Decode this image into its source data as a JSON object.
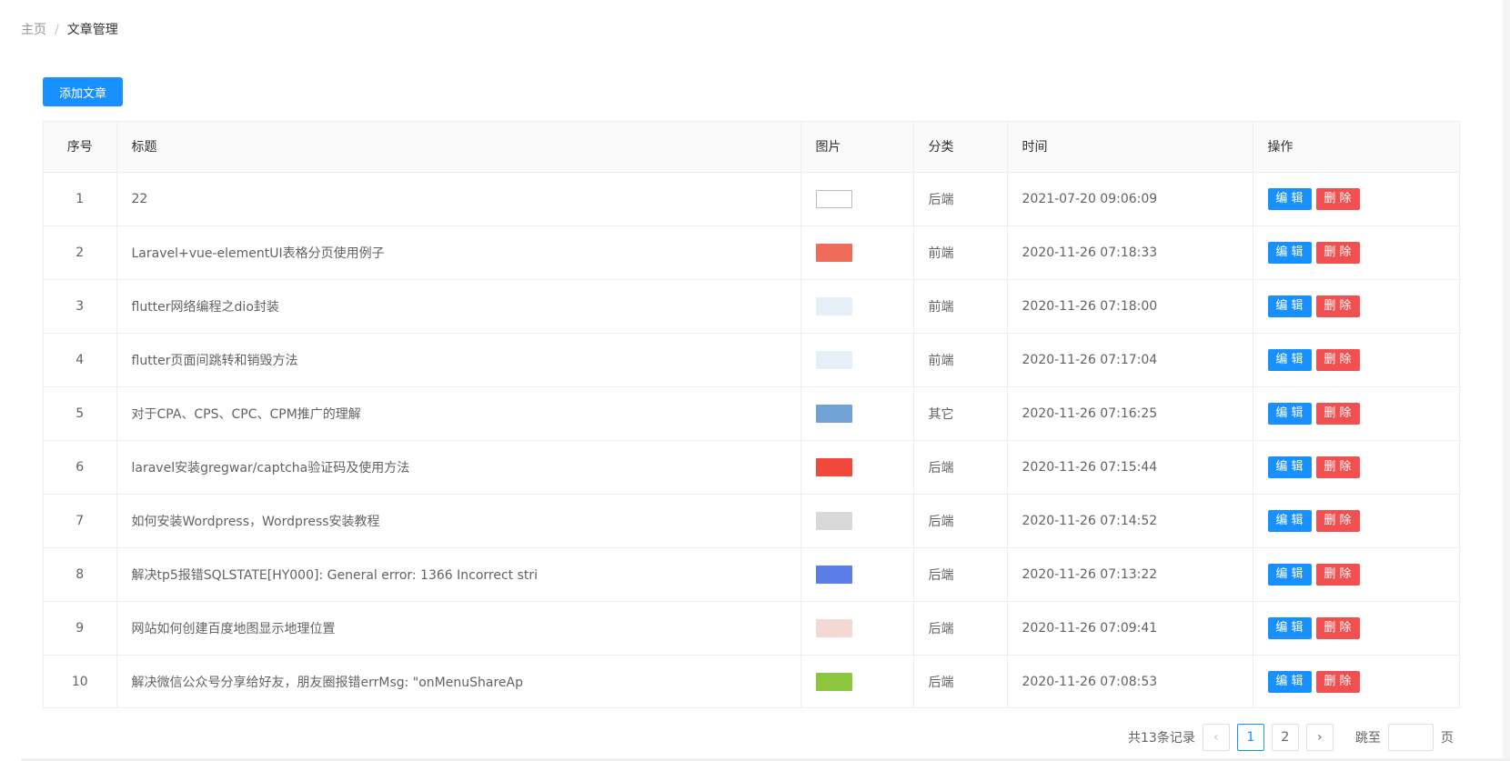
{
  "breadcrumb": {
    "home": "主页",
    "separator": "/",
    "current": "文章管理"
  },
  "toolbar": {
    "add_label": "添加文章"
  },
  "table": {
    "headers": [
      "序号",
      "标题",
      "图片",
      "分类",
      "时间",
      "操作"
    ],
    "edit_label": "编 辑",
    "delete_label": "删 除",
    "rows": [
      {
        "idx": "1",
        "title": "22",
        "category": "后端",
        "time": "2021-07-20 09:06:09",
        "thumb_color": "#ffffff"
      },
      {
        "idx": "2",
        "title": "Laravel+vue-elementUI表格分页使用例子",
        "category": "前端",
        "time": "2020-11-26 07:18:33",
        "thumb_color": "#ef6b5a"
      },
      {
        "idx": "3",
        "title": "flutter网络编程之dio封装",
        "category": "前端",
        "time": "2020-11-26 07:18:00",
        "thumb_color": "#e6eef8"
      },
      {
        "idx": "4",
        "title": "flutter页面间跳转和销毁方法",
        "category": "前端",
        "time": "2020-11-26 07:17:04",
        "thumb_color": "#e6eef8"
      },
      {
        "idx": "5",
        "title": "对于CPA、CPS、CPC、CPM推广的理解",
        "category": "其它",
        "time": "2020-11-26 07:16:25",
        "thumb_color": "#6fa3d6"
      },
      {
        "idx": "6",
        "title": "laravel安装gregwar/captcha验证码及使用方法",
        "category": "后端",
        "time": "2020-11-26 07:15:44",
        "thumb_color": "#f0483a"
      },
      {
        "idx": "7",
        "title": "如何安装Wordpress，Wordpress安装教程",
        "category": "后端",
        "time": "2020-11-26 07:14:52",
        "thumb_color": "#d9d9d9"
      },
      {
        "idx": "8",
        "title": "解决tp5报错SQLSTATE[HY000]: General error: 1366 Incorrect stri",
        "category": "后端",
        "time": "2020-11-26 07:13:22",
        "thumb_color": "#5b7de8"
      },
      {
        "idx": "9",
        "title": "网站如何创建百度地图显示地理位置",
        "category": "后端",
        "time": "2020-11-26 07:09:41",
        "thumb_color": "#f3d8d4"
      },
      {
        "idx": "10",
        "title": "解决微信公众号分享给好友，朋友圈报错errMsg: \"onMenuShareAp",
        "category": "后端",
        "time": "2020-11-26 07:08:53",
        "thumb_color": "#8cc63f"
      }
    ]
  },
  "pagination": {
    "total_text": "共13条记录",
    "prev_icon": "‹",
    "next_icon": "›",
    "pages": [
      "1",
      "2"
    ],
    "current_page": "1",
    "jump_label": "跳至",
    "page_unit": "页",
    "jump_value": ""
  },
  "colors": {
    "primary": "#1890ff",
    "danger": "#f05050"
  }
}
